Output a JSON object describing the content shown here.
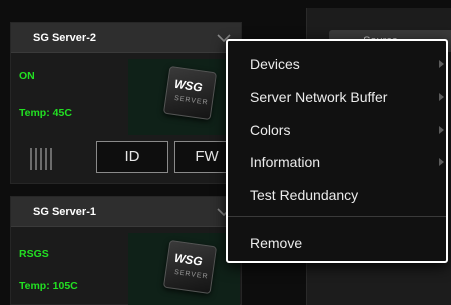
{
  "right_panel": {
    "source_header": "Source"
  },
  "servers": [
    {
      "name": "SG Server-2",
      "status": "ON",
      "temp": "Temp: 45C",
      "logo_text": "WSG",
      "logo_sub": "SERVER"
    },
    {
      "name": "SG Server-1",
      "status": "RSGS",
      "temp": "Temp: 105C",
      "logo_text": "WSG",
      "logo_sub": "SERVER"
    }
  ],
  "buttons": {
    "id_label": "ID",
    "fw_label": "FW"
  },
  "context_menu": {
    "items": [
      {
        "label": "Devices",
        "has_submenu": true
      },
      {
        "label": "Server Network Buffer",
        "has_submenu": true
      },
      {
        "label": "Colors",
        "has_submenu": true
      },
      {
        "label": "Information",
        "has_submenu": true
      },
      {
        "label": "Test Redundancy",
        "has_submenu": false
      },
      {
        "label": "Remove",
        "has_submenu": false
      }
    ]
  },
  "colors": {
    "status_green": "#22e022",
    "menu_border": "#ffffff",
    "background": "#0d0d0d"
  }
}
